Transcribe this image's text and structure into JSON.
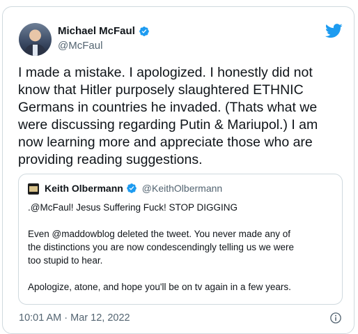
{
  "tweet": {
    "author": {
      "display_name": "Michael McFaul",
      "handle": "@McFaul",
      "verified": true
    },
    "text": "I made a mistake. I apologized. I honestly did not\nknow that Hitler purposely slaughtered ETHNIC\nGermans in countries he invaded. (Thats what we\nwere discussing regarding Putin & Mariupol.) I am\nnow learning more and appreciate those who are\nproviding reading suggestions.",
    "timestamp": "10:01 AM · Mar 12, 2022",
    "icons": {
      "brand": "twitter-bird-icon",
      "verified": "verified-badge-icon",
      "info": "info-icon"
    },
    "colors": {
      "brand": "#1d9bf0",
      "text": "#0f1419",
      "secondary": "#536471",
      "border": "#cfd9de"
    }
  },
  "quote": {
    "author": {
      "display_name": "Keith Olbermann",
      "handle": "@KeithOlbermann",
      "verified": true
    },
    "text": ".@McFaul! Jesus Suffering Fuck! STOP DIGGING\n\nEven @maddowblog deleted the tweet. You never made any of\nthe distinctions you are now condescendingly telling us we were\ntoo stupid to hear.\n\nApologize, atone, and hope you'll be on tv again in a few years."
  }
}
